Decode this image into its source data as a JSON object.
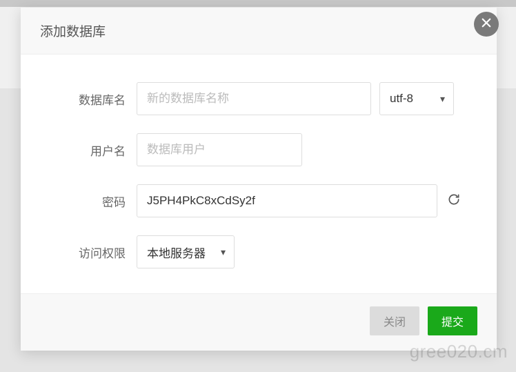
{
  "dialog": {
    "title": "添加数据库",
    "fields": {
      "dbName": {
        "label": "数据库名",
        "placeholder": "新的数据库名称",
        "value": ""
      },
      "encoding": {
        "selected": "utf-8"
      },
      "username": {
        "label": "用户名",
        "placeholder": "数据库用户",
        "value": ""
      },
      "password": {
        "label": "密码",
        "value": "J5PH4PkC8xCdSy2f"
      },
      "access": {
        "label": "访问权限",
        "selected": "本地服务器"
      }
    },
    "buttons": {
      "cancel": "关闭",
      "submit": "提交"
    }
  },
  "watermark": "gree020.cm"
}
